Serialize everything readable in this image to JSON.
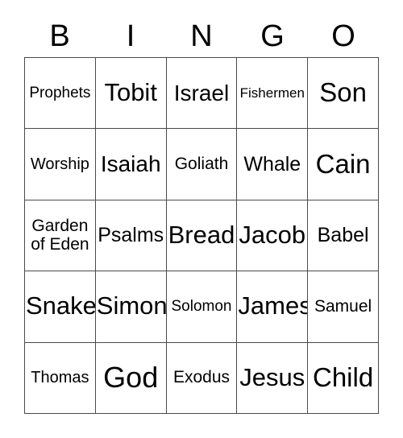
{
  "card": {
    "title_letters": [
      "B",
      "I",
      "N",
      "G",
      "O"
    ],
    "columns": 5,
    "rows": 5,
    "border_color": "#4a4a4a",
    "background_color": "#ffffff",
    "text_color": "#000000",
    "cells": [
      [
        {
          "label": "Prophets",
          "size": "fs-sm"
        },
        {
          "label": "Tobit",
          "size": "fs-xxl"
        },
        {
          "label": "Israel",
          "size": "fs-xl"
        },
        {
          "label": "Fishermen",
          "size": "fs-xs"
        },
        {
          "label": "Son",
          "size": "fs-3xl"
        }
      ],
      [
        {
          "label": "Worship",
          "size": "fs-smp"
        },
        {
          "label": "Isaiah",
          "size": "fs-xl"
        },
        {
          "label": "Goliath",
          "size": "fs-md"
        },
        {
          "label": "Whale",
          "size": "fs-lg"
        },
        {
          "label": "Cain",
          "size": "fs-3xl"
        }
      ],
      [
        {
          "label": "Garden of Eden",
          "size": "fs-md",
          "multiline": true
        },
        {
          "label": "Psalms",
          "size": "fs-lg"
        },
        {
          "label": "Bread",
          "size": "fs-xxl"
        },
        {
          "label": "Jacob",
          "size": "fs-xxl"
        },
        {
          "label": "Babel",
          "size": "fs-lg"
        }
      ],
      [
        {
          "label": "Snake",
          "size": "fs-xxl"
        },
        {
          "label": "Simon",
          "size": "fs-xxl"
        },
        {
          "label": "Solomon",
          "size": "fs-sm"
        },
        {
          "label": "James",
          "size": "fs-xxl"
        },
        {
          "label": "Samuel",
          "size": "fs-md"
        }
      ],
      [
        {
          "label": "Thomas",
          "size": "fs-smp"
        },
        {
          "label": "God",
          "size": "fs-4xl"
        },
        {
          "label": "Exodus",
          "size": "fs-md"
        },
        {
          "label": "Jesus",
          "size": "fs-xxl"
        },
        {
          "label": "Child",
          "size": "fs-3xl"
        }
      ]
    ]
  }
}
